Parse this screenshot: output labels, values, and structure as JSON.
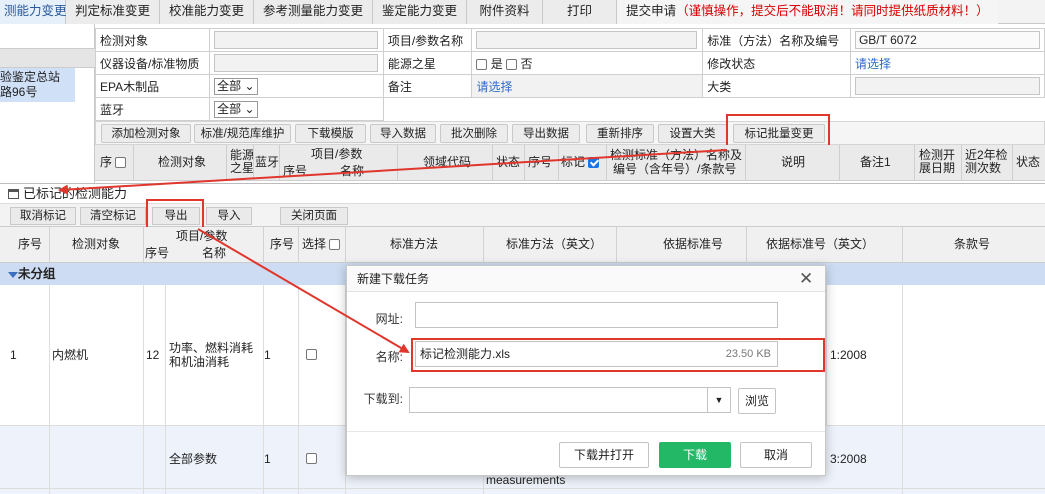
{
  "tabs": [
    "测能力变更",
    "判定标准变更",
    "校准能力变更",
    "参考测量能力变更",
    "鉴定能力变更",
    "附件资料",
    "打印"
  ],
  "submit_tab": {
    "label": "提交申请",
    "warning": "（谨慎操作，提交后不能取消！请同时提供纸质材料！）"
  },
  "left_panel": {
    "selected_text_1": "验鉴定总站",
    "selected_text_2": "路96号"
  },
  "form": {
    "test_object_label": "检测对象",
    "item_param_label": "项目/参数名称",
    "standard_label": "标准（方法）名称及编号",
    "standard_value": "GB/T 6072",
    "instrument_label": "仪器设备/标准物质",
    "energy_star_label": "能源之星",
    "yes_label": "是",
    "no_label": "否",
    "modify_status_label": "修改状态",
    "modify_status_value": "请选择",
    "epa_label": "EPA木制品",
    "epa_select": "全部",
    "remark_label": "备注",
    "remark_value": "请选择",
    "category_label": "大类",
    "bluetooth_label": "蓝牙",
    "bluetooth_select": "全部"
  },
  "toolbar": [
    "添加检测对象",
    "标准/规范库维护",
    "下载模版",
    "导入数据",
    "批次删除",
    "导出数据",
    "重新排序",
    "设置大类",
    "标记批量变更"
  ],
  "table_header": {
    "seq": "序",
    "test_object": "检测对象",
    "energy": "能源\n之星",
    "bt": "蓝牙",
    "item_seq": "序号",
    "item_param": "项目/参数",
    "item_name": "名称",
    "domain_code": "领域代码",
    "status": "状态",
    "seq2": "序号",
    "mark": "标记",
    "std_method": "检测标准（方法）名称及",
    "std_method2": "编号（含年号）/条款号",
    "desc": "说明",
    "remark1": "备注1",
    "start_date": "检测开\n展日期",
    "recent_count": "近2年检\n测次数",
    "status2": "状态"
  },
  "marked_panel": {
    "title": "已标记的检测能力",
    "buttons": [
      "取消标记",
      "清空标记",
      "导出",
      "导入",
      "关闭页面"
    ],
    "headers": {
      "seq": "序号",
      "test_object": "检测对象",
      "item_param": "项目/参数",
      "item_seq": "序号",
      "item_name": "名称",
      "seq2": "序号",
      "select": "选择",
      "std_method": "标准方法",
      "std_method_en": "标准方法（英文）",
      "basis_no": "依据标准号",
      "basis_no_en": "依据标准号（英文）",
      "clause": "条款号"
    },
    "group": "未分组",
    "rows": [
      {
        "seq": "1",
        "object": "内燃机",
        "item_seq": "12",
        "item_name": "功率、燃料消耗和机油消耗",
        "seq2": "1",
        "basis_tail": "1:2008"
      },
      {
        "seq": "",
        "object": "",
        "item_seq": "",
        "item_name": "全部参数",
        "seq2": "1",
        "basis_tail": "3:2008"
      }
    ],
    "peek_text": "measurements"
  },
  "dialog": {
    "title": "新建下载任务",
    "url_label": "网址:",
    "url_value": "",
    "name_label": "名称:",
    "name_value": "标记检测能力.xls",
    "size": "23.50 KB",
    "dest_label": "下载到:",
    "dest_value": "",
    "browse": "浏览",
    "download_open": "下载并打开",
    "download": "下载",
    "cancel": "取消"
  },
  "colors": {
    "accent_red": "#e0362c",
    "download_green": "#22b865",
    "group_blue": "#cddcf2"
  }
}
